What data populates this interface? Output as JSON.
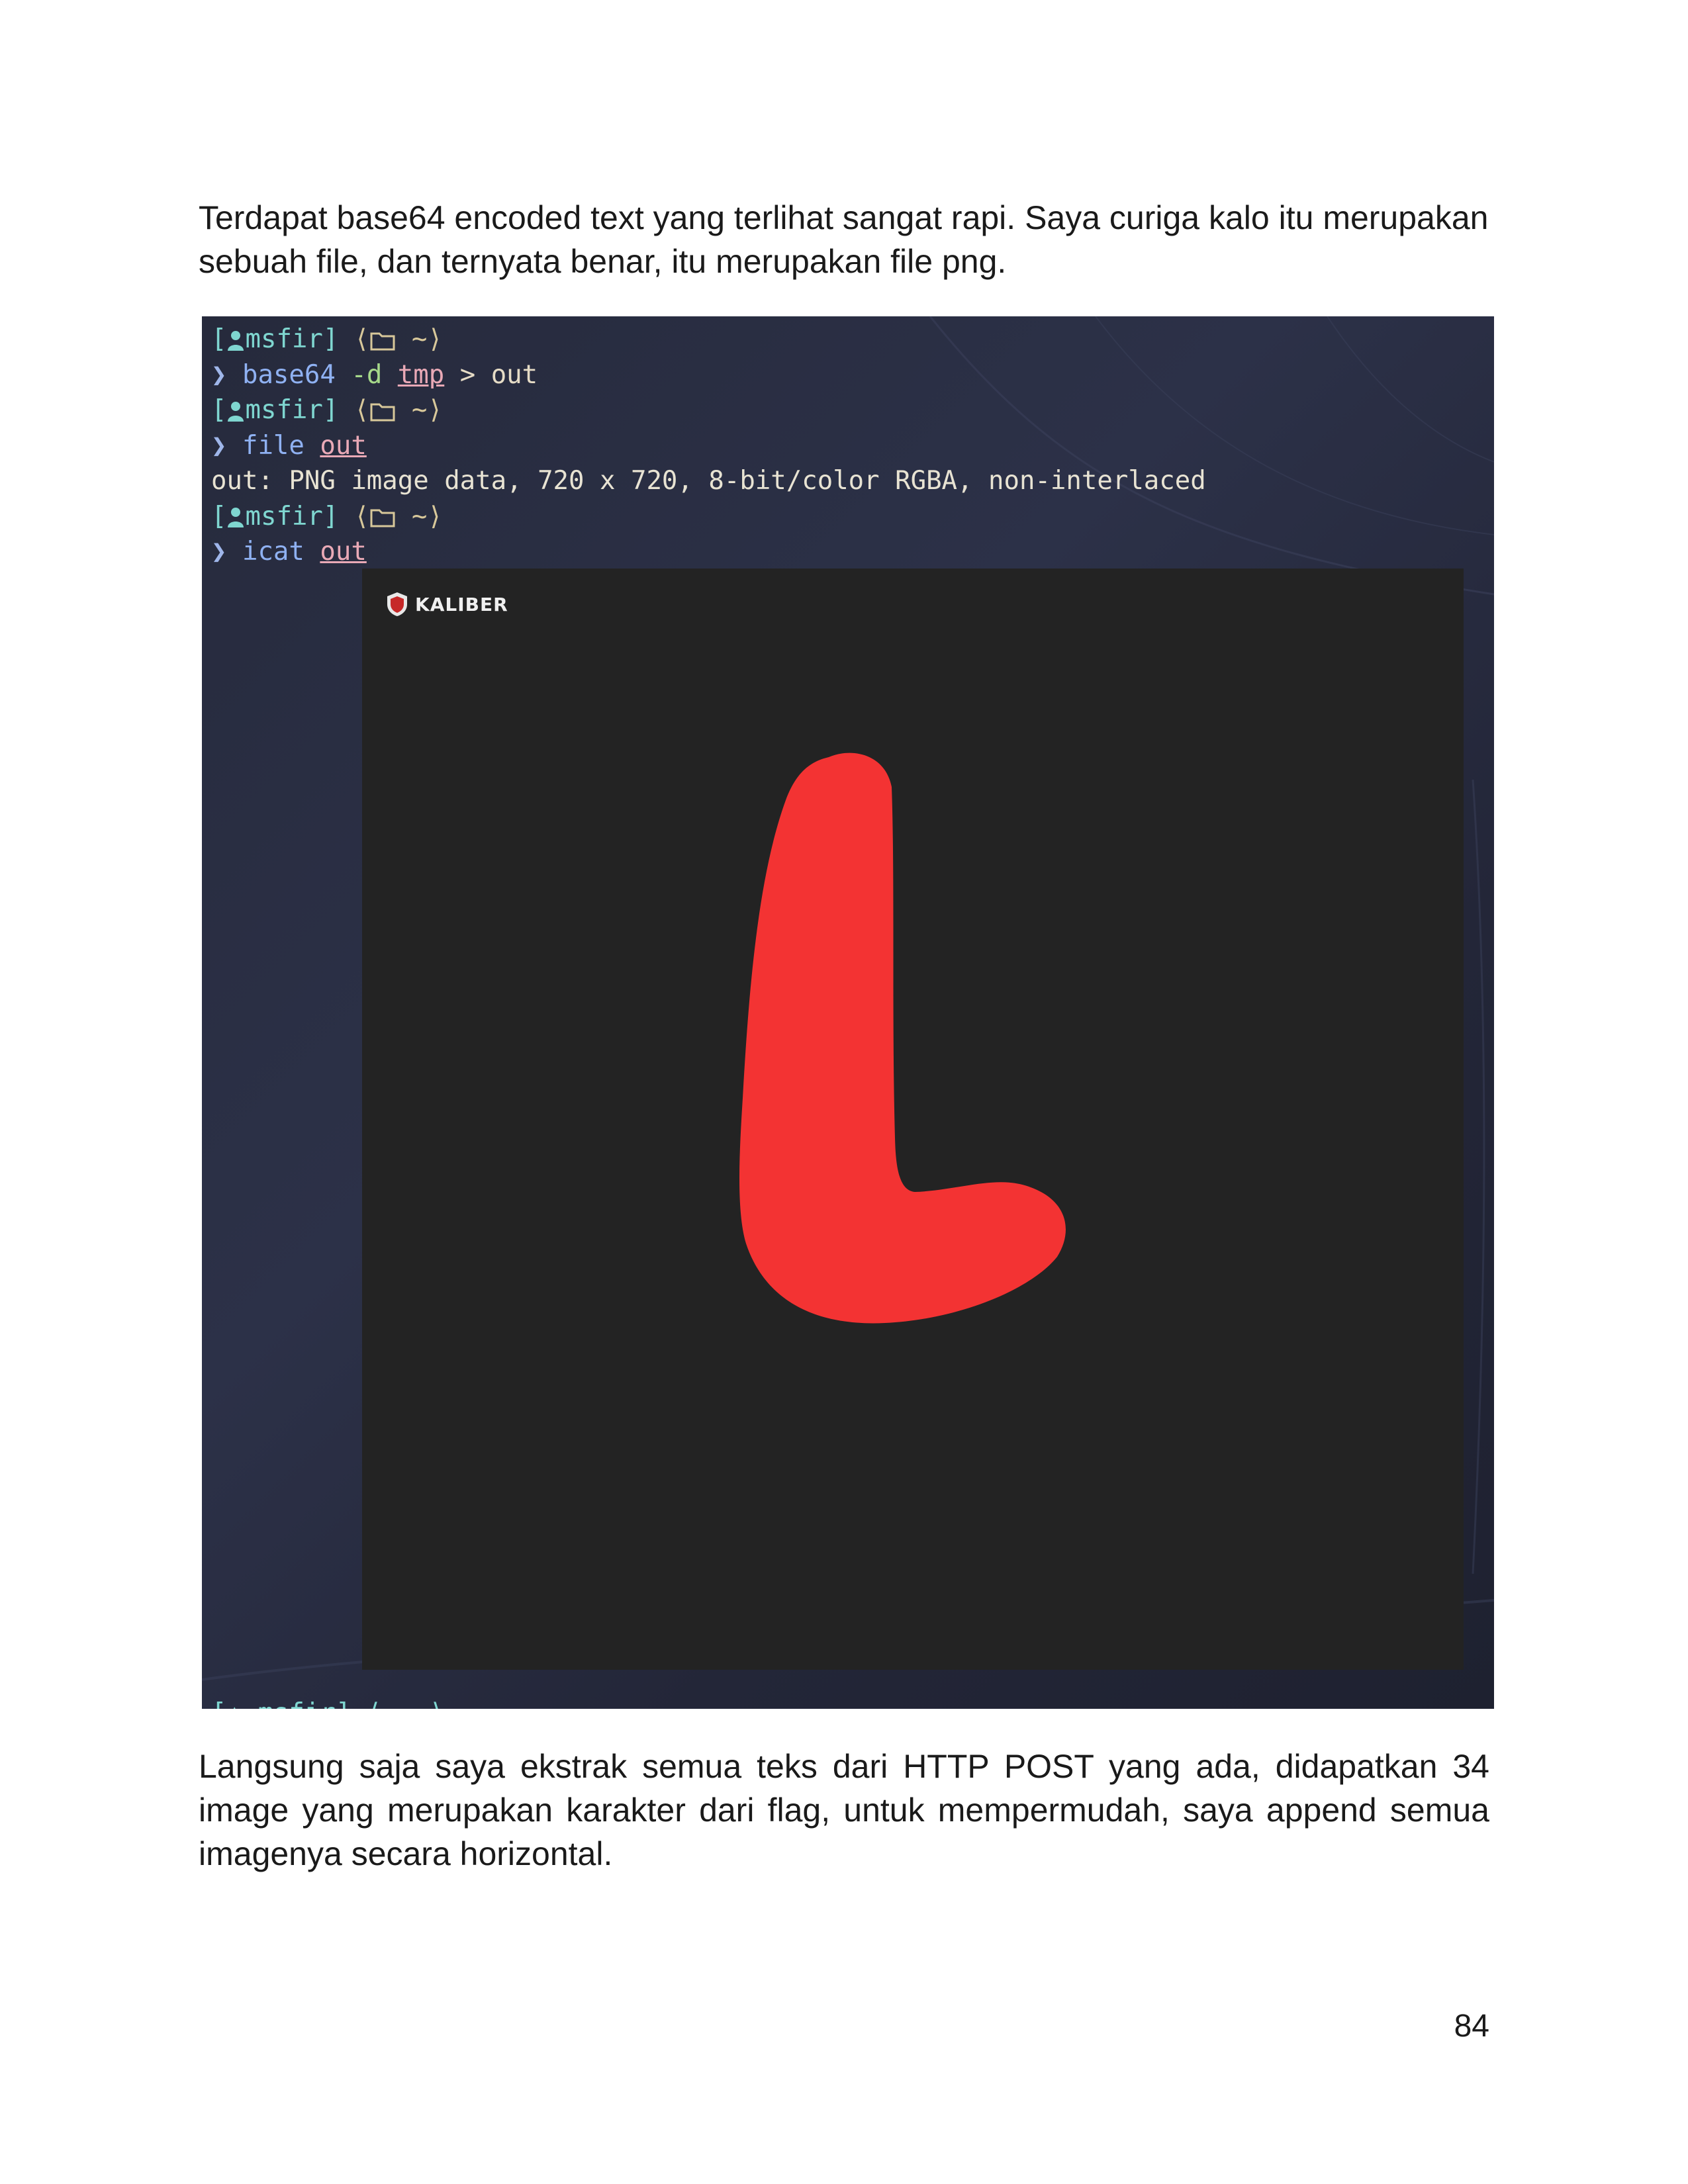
{
  "paragraph_1": "Terdapat base64 encoded text yang terlihat sangat rapi. Saya curiga kalo itu merupakan sebuah file, dan ternyata benar, itu merupakan file png.",
  "terminal": {
    "user": "msfir",
    "dir": "~",
    "prompt_char": "❯",
    "cmd1": {
      "name": "base64",
      "flag": "-d",
      "arg": "tmp",
      "redirect": ">",
      "target": "out"
    },
    "cmd2": {
      "name": "file",
      "arg": "out"
    },
    "output": "out: PNG image data, 720 x 720, 8-bit/color RGBA, non-interlaced",
    "cmd3": {
      "name": "icat",
      "arg": "out"
    },
    "image_logo": "KALIBER",
    "image_letter": "L",
    "letter_color": "#f33333",
    "image_background": "#232323"
  },
  "paragraph_2": "Langsung saja saya ekstrak semua teks dari HTTP POST yang ada, didapatkan 34 image yang merupakan karakter dari flag, untuk mempermudah, saya append semua imagenya secara horizontal.",
  "page_number": "84"
}
